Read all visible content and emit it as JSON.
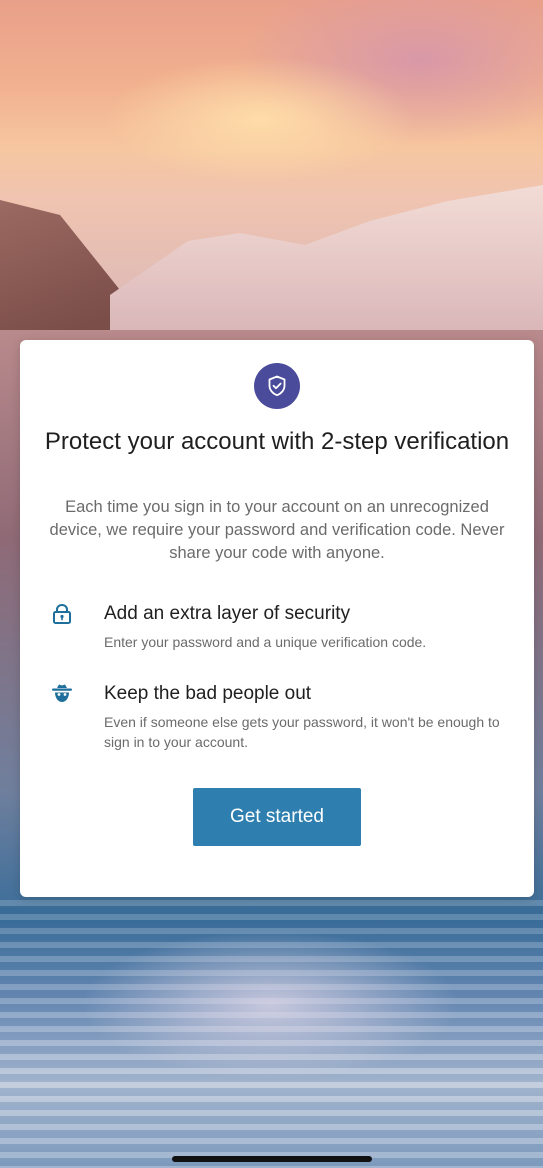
{
  "card": {
    "icon": "shield-check-icon",
    "title": "Protect your account with 2-step verification",
    "description": "Each time you sign in to your account on an unrecognized device, we require your password and verification code. Never share your code with anyone."
  },
  "features": [
    {
      "icon": "lock-icon",
      "title": "Add an extra layer of security",
      "text": "Enter your password and a unique verification code."
    },
    {
      "icon": "spy-icon",
      "title": "Keep the bad people out",
      "text": "Even if someone else gets your password, it won't be enough to sign in to your account."
    }
  ],
  "cta": {
    "label": "Get started"
  },
  "colors": {
    "accent": "#2e7fb0",
    "badge": "#4b4b9b",
    "icon": "#1f6f9c"
  }
}
